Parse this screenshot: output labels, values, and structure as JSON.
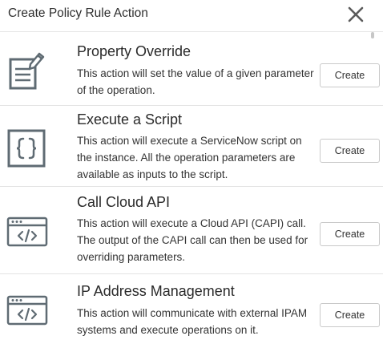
{
  "dialog": {
    "title": "Create Policy Rule Action",
    "close_icon": "close-icon"
  },
  "actions": [
    {
      "title": "Property Override",
      "description": "This action will set the value of a given parameter of the operation.",
      "button_label": "Create",
      "icon": "document-edit-icon"
    },
    {
      "title": "Execute a Script",
      "description": "This action will execute a ServiceNow script on the instance. All the operation parameters are available as inputs to the script.",
      "button_label": "Create",
      "icon": "curly-braces-icon"
    },
    {
      "title": "Call Cloud API",
      "description": "This action will execute a Cloud API (CAPI) call. The output of the CAPI call can then be used for overriding parameters.",
      "button_label": "Create",
      "icon": "code-window-icon"
    },
    {
      "title": "IP Address Management",
      "description": "This action will communicate with external IPAM systems and execute operations on it.",
      "button_label": "Create",
      "icon": "code-window-icon"
    }
  ],
  "colors": {
    "icon_stroke": "#5f6b73",
    "divider": "#e3e3e3",
    "button_border": "#c9c9c9"
  }
}
